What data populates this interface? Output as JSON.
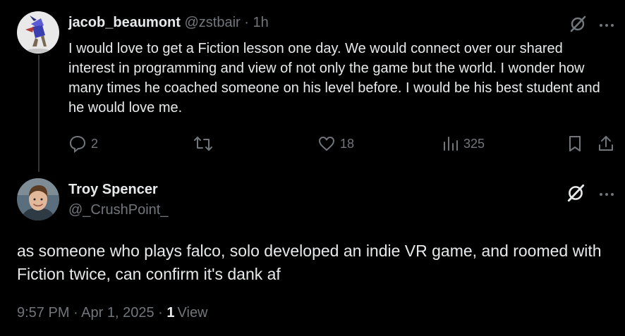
{
  "reply": {
    "display_name": "jacob_beaumont",
    "handle": "@zstbair",
    "separator": "·",
    "time": "1h",
    "text": "I would love to get a Fiction lesson one day. We would connect over our shared interest in programming and  view of not only the game but the world. I wonder how many times he coached someone on his level before. I would be his best student and he would love me.",
    "actions": {
      "replies": "2",
      "reposts": "",
      "likes": "18",
      "views": "325"
    }
  },
  "main_post": {
    "display_name": "Troy Spencer",
    "handle": "@_CrushPoint_",
    "text": "as someone who plays falco, solo developed an indie VR game, and roomed with Fiction twice, can confirm it's dank af",
    "time": "9:57 PM",
    "separator": "·",
    "date": "Apr 1, 2025",
    "views_count": "1",
    "views_label": "View"
  },
  "colors": {
    "background": "#000000",
    "text": "#e7e9ea",
    "muted": "#71767b",
    "thread_line": "#333639"
  },
  "icons": [
    "grok-icon",
    "more-icon",
    "reply-icon",
    "repost-icon",
    "like-icon",
    "views-icon",
    "bookmark-icon",
    "share-icon"
  ]
}
